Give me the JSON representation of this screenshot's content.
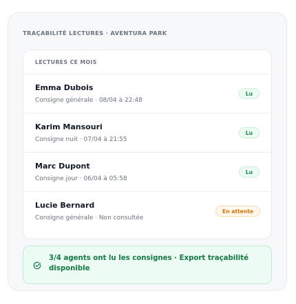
{
  "panel": {
    "title": "TRAÇABILITÉ LECTURES · AVENTURA PARK"
  },
  "card": {
    "header": "LECTURES CE MOIS"
  },
  "rows": [
    {
      "name": "Emma Dubois",
      "detail": "Consigne générale · 08/04 à 22:48",
      "status": "Lu",
      "status_type": "read"
    },
    {
      "name": "Karim Mansouri",
      "detail": "Consigne nuit · 07/04 à 21:55",
      "status": "Lu",
      "status_type": "read"
    },
    {
      "name": "Marc Dupont",
      "detail": "Consigne jour · 06/04 à 05:58",
      "status": "Lu",
      "status_type": "read"
    },
    {
      "name": "Lucie Bernard",
      "detail": "Consigne générale · Non consultée",
      "status": "En attente",
      "status_type": "pending"
    }
  ],
  "notice": {
    "icon": "check-circle-icon",
    "text": "3/4 agents ont lu les consignes · Export traçabilité disponible"
  },
  "colors": {
    "success": "#1f8a4c",
    "success_bg": "#ecfdf3",
    "pending": "#d97706",
    "pending_bg": "#fff7ed",
    "notice_text": "#137a43"
  }
}
